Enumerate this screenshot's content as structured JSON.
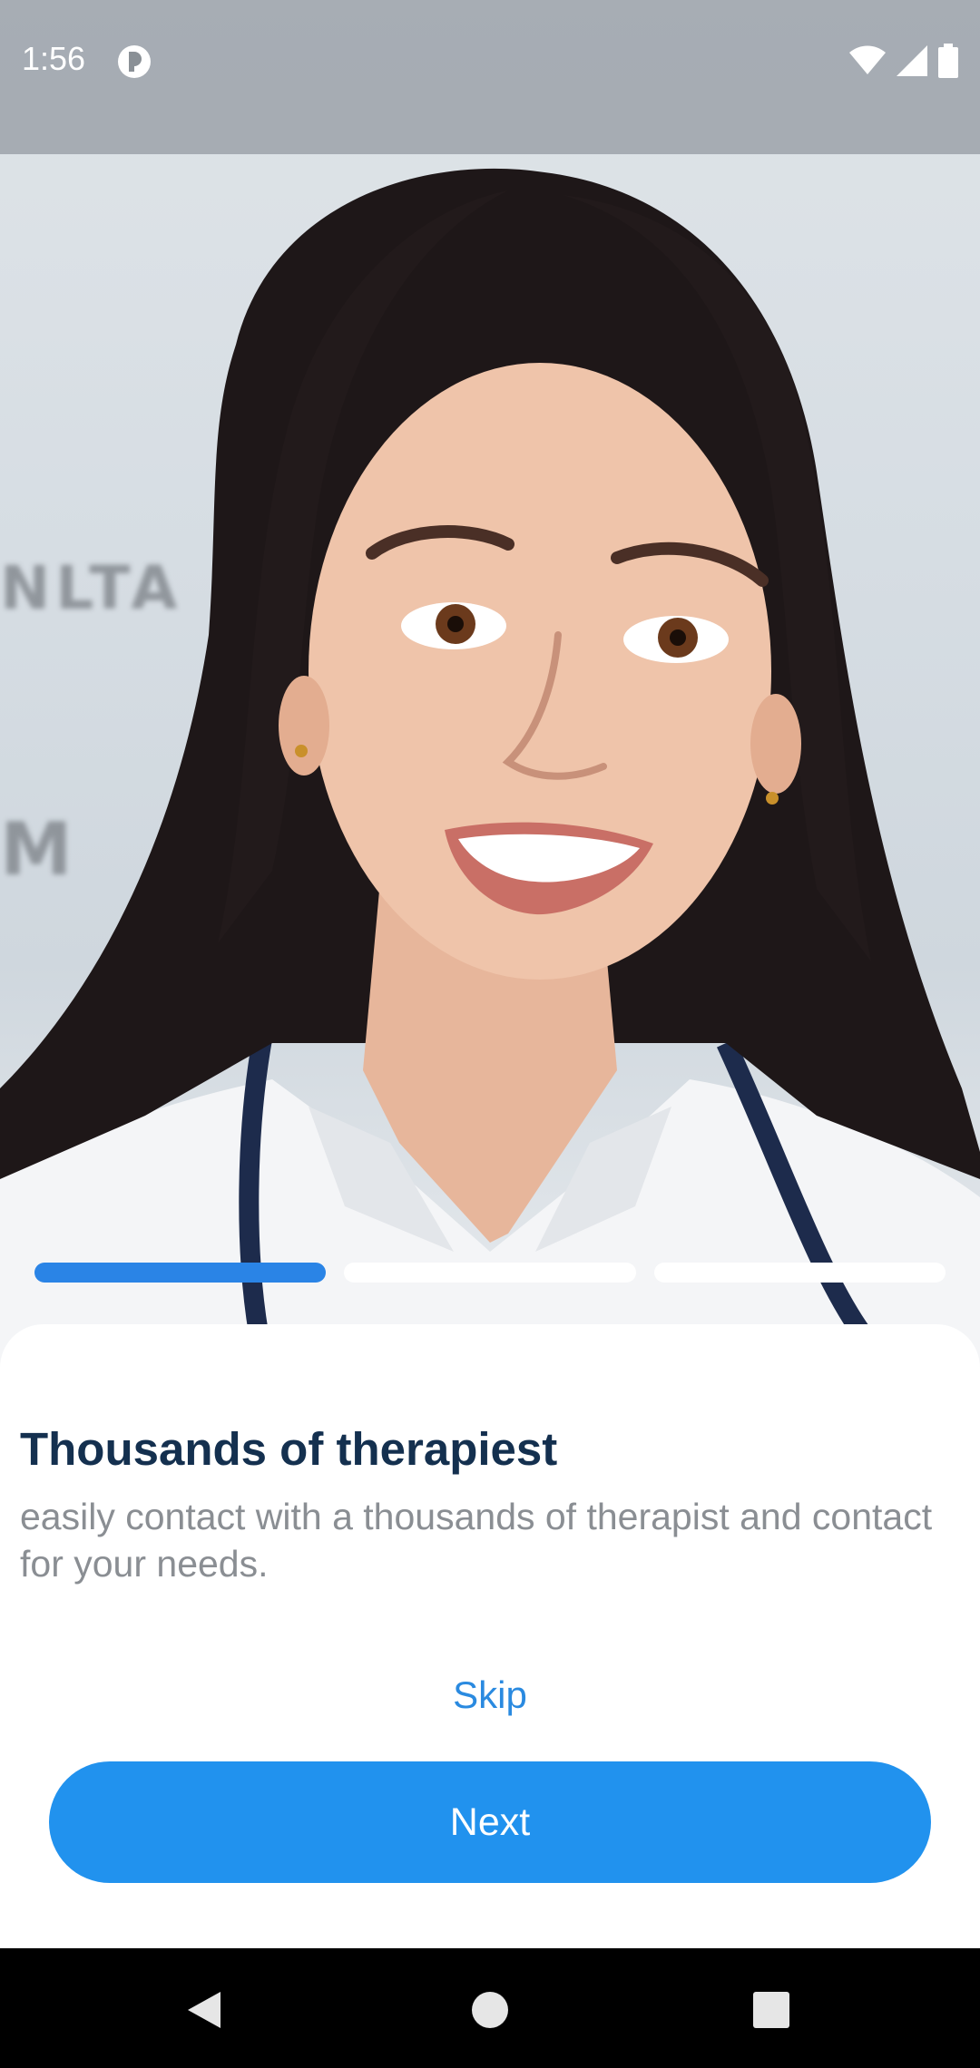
{
  "status_bar": {
    "time": "1:56",
    "icons": [
      "app-notification-icon",
      "wifi-icon",
      "signal-icon",
      "battery-icon"
    ]
  },
  "hero": {
    "image": "smiling-doctor-with-stethoscope-photo",
    "eye_chart_rows": [
      "",
      "",
      "",
      "",
      "",
      "",
      "NLTA",
      "",
      "M"
    ]
  },
  "pager": {
    "pages": 3,
    "current": 1,
    "active_color": "#2a84e6",
    "inactive_color": "#ffffff"
  },
  "onboarding": {
    "title": "Thousands of therapiest",
    "description": "easily contact with a thousands of therapist and contact for your needs.",
    "skip_label": "Skip",
    "next_label": "Next",
    "accent_color": "#2192ee"
  },
  "nav_bar": {
    "buttons": [
      "back-icon",
      "home-icon",
      "recents-icon"
    ]
  }
}
